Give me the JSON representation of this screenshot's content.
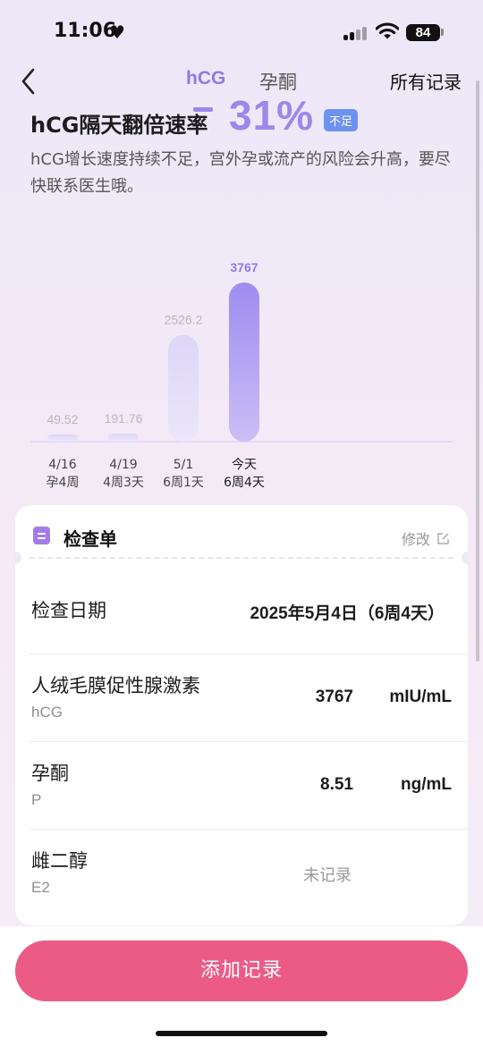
{
  "status_bar": {
    "time": "11:06",
    "battery": "84"
  },
  "nav": {
    "tabs": [
      "hCG",
      "孕酮"
    ],
    "all_records": "所有记录"
  },
  "rate": {
    "title": "hCG隔天翻倍速率",
    "value": "31%",
    "badge": "不足"
  },
  "description": "hCG增长速度持续不足，宫外孕或流产的风险会升高，要尽快联系医生哦。",
  "colors": {
    "accent": "#9a88ea",
    "badge": "#6d93f0",
    "button": "#ec5b86"
  },
  "chart_data": {
    "type": "bar",
    "categories": [
      "4/16 孕4周",
      "4/19 4周3天",
      "5/1 6周1天",
      "今天 6周4天"
    ],
    "x_labels": [
      {
        "date": "4/16",
        "week": "孕4周"
      },
      {
        "date": "4/19",
        "week": "4周3天"
      },
      {
        "date": "5/1",
        "week": "6周1天"
      },
      {
        "date": "今天",
        "week": "6周4天"
      }
    ],
    "values": [
      49.52,
      191.76,
      2526.2,
      3767
    ],
    "value_labels": [
      "49.52",
      "191.76",
      "2526.2",
      "3767"
    ],
    "highlight_index": 3
  },
  "card": {
    "title": "检查单",
    "edit_label": "修改",
    "rows": [
      {
        "label": "检查日期",
        "value": "2025年5月4日（6周4天）"
      },
      {
        "label": "人绒毛膜促性腺激素",
        "sub": "hCG",
        "value": "3767",
        "unit": "mIU/mL"
      },
      {
        "label": "孕酮",
        "sub": "P",
        "value": "8.51",
        "unit": "ng/mL"
      },
      {
        "label": "雌二醇",
        "sub": "E2",
        "value": "未记录"
      }
    ]
  },
  "add_button": "添加记录"
}
